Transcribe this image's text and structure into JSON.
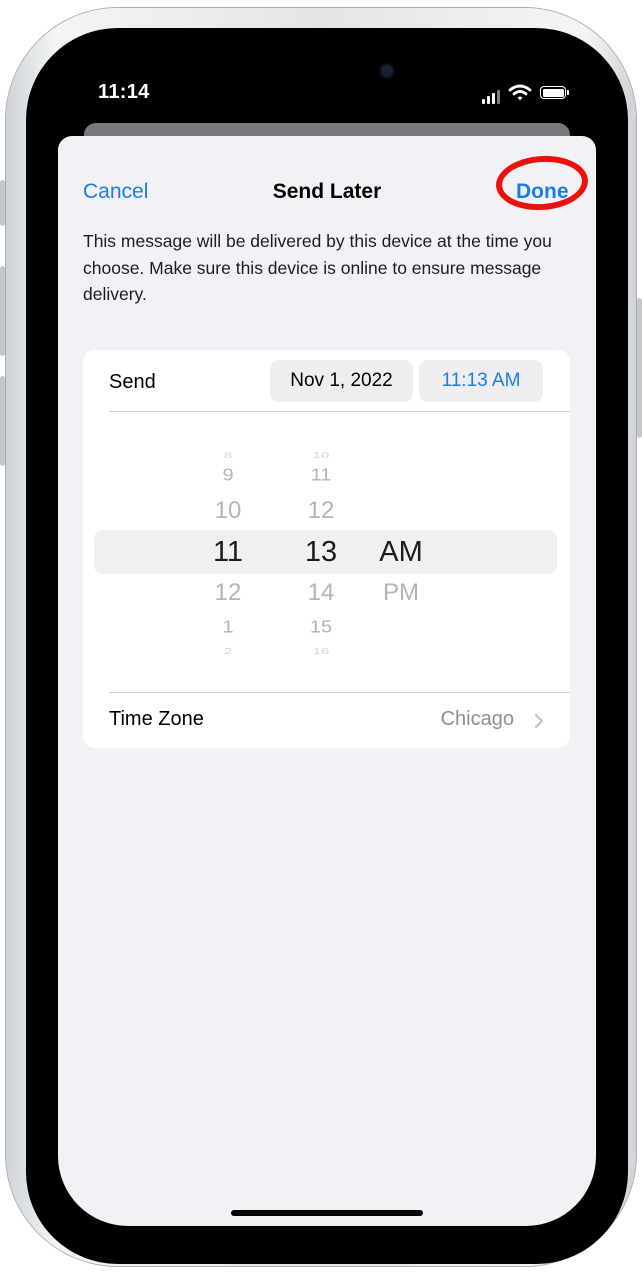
{
  "status_bar": {
    "time": "11:14"
  },
  "nav": {
    "cancel_label": "Cancel",
    "title": "Send Later",
    "done_label": "Done"
  },
  "description": "This message will be delivered by this device at the time you choose. Make sure this device is online to ensure message delivery.",
  "send_row": {
    "label": "Send",
    "date": "Nov 1, 2022",
    "time": "11:13 AM"
  },
  "picker": {
    "hours": [
      "8",
      "9",
      "10",
      "11",
      "12",
      "1",
      "2"
    ],
    "minutes": [
      "10",
      "11",
      "12",
      "13",
      "14",
      "15",
      "16"
    ],
    "period": [
      "AM",
      "PM"
    ],
    "selected_hour": "11",
    "selected_minute": "13",
    "selected_period": "AM"
  },
  "time_zone": {
    "label": "Time Zone",
    "value": "Chicago"
  },
  "colors": {
    "accent": "#1a7ee8",
    "annotation": "#ee0f0f"
  },
  "icons": [
    "signal-icon",
    "wifi-icon",
    "battery-icon",
    "chevron-right-icon"
  ]
}
